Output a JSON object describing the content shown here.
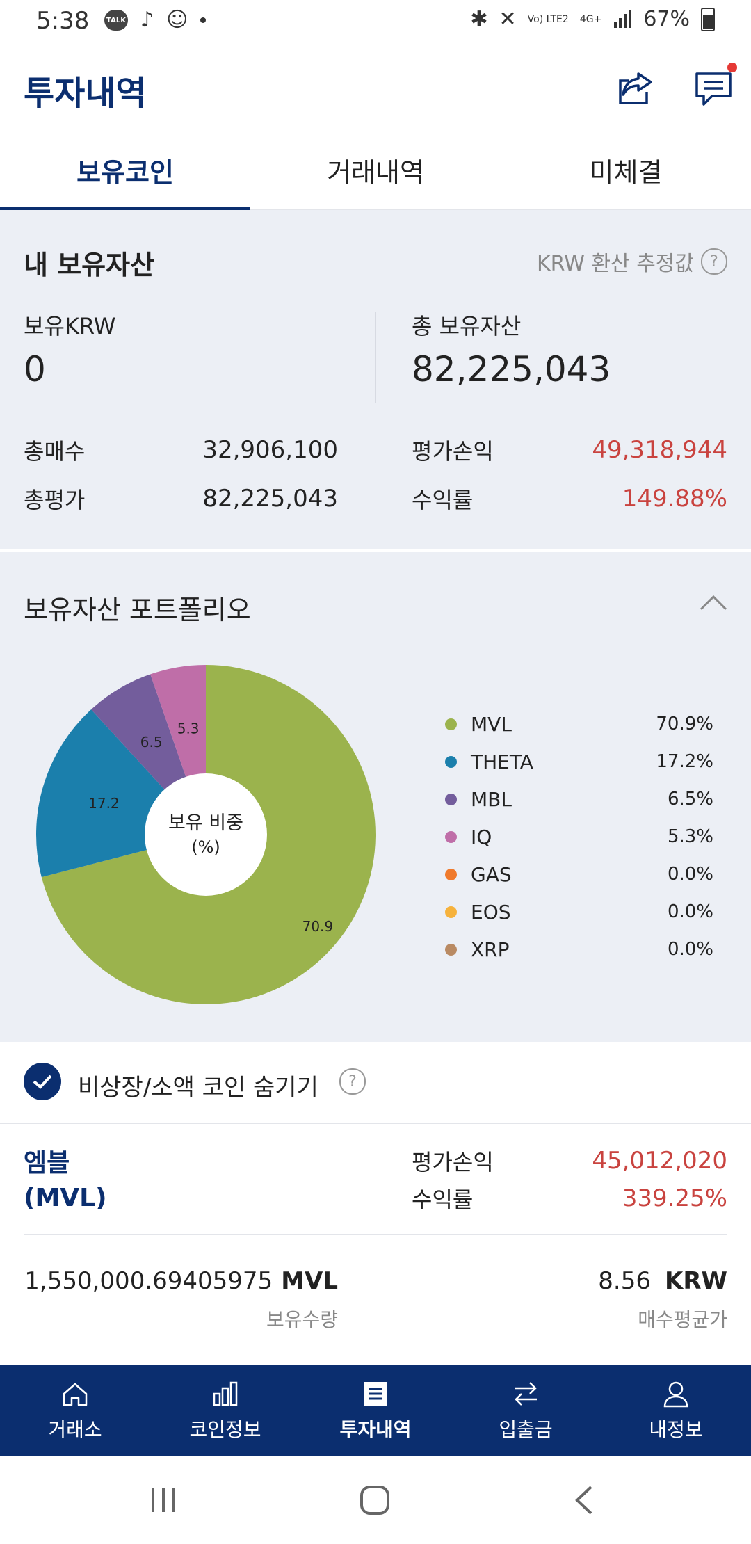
{
  "status_bar": {
    "time": "5:38",
    "talk_label": "TALK",
    "network": "Vo) LTE2",
    "net_type": "4G+",
    "battery": "67%"
  },
  "header": {
    "title": "투자내역"
  },
  "tabs": [
    {
      "label": "보유코인",
      "active": true
    },
    {
      "label": "거래내역",
      "active": false
    },
    {
      "label": "미체결",
      "active": false
    }
  ],
  "assets": {
    "title": "내 보유자산",
    "krw_note": "KRW 환산 추정값",
    "help_symbol": "?",
    "krw_label": "보유KRW",
    "krw_value": "0",
    "total_label": "총 보유자산",
    "total_value": "82,225,043",
    "total_buy_label": "총매수",
    "total_buy_value": "32,906,100",
    "total_eval_label": "총평가",
    "total_eval_value": "82,225,043",
    "pnl_label": "평가손익",
    "pnl_value": "49,318,944",
    "return_label": "수익률",
    "return_value": "149.88%"
  },
  "portfolio": {
    "title": "보유자산 포트폴리오",
    "center_label_1": "보유 비중",
    "center_label_2": "(%)",
    "colors": {
      "MVL": "#9bb34d",
      "THETA": "#1b7fac",
      "MBL": "#735d9c",
      "IQ": "#bf6ea8",
      "GAS": "#f07a2c",
      "EOS": "#f6b23c",
      "XRP": "#b98a63"
    },
    "legend": [
      {
        "name": "MVL",
        "pct": "70.9%"
      },
      {
        "name": "THETA",
        "pct": "17.2%"
      },
      {
        "name": "MBL",
        "pct": "6.5%"
      },
      {
        "name": "IQ",
        "pct": "5.3%"
      },
      {
        "name": "GAS",
        "pct": "0.0%"
      },
      {
        "name": "EOS",
        "pct": "0.0%"
      },
      {
        "name": "XRP",
        "pct": "0.0%"
      }
    ]
  },
  "chart_data": {
    "type": "pie",
    "title": "보유 비중 (%)",
    "categories": [
      "MVL",
      "THETA",
      "MBL",
      "IQ",
      "GAS",
      "EOS",
      "XRP"
    ],
    "values": [
      70.9,
      17.2,
      6.5,
      5.3,
      0.0,
      0.0,
      0.0
    ],
    "data_labels": [
      "70.9",
      "17.2",
      "6.5",
      "5.3"
    ],
    "legend_placement": "right"
  },
  "hide_small": {
    "label": "비상장/소액 코인 숨기기",
    "checked": true
  },
  "coin": {
    "name": "엠블",
    "symbol": "(MVL)",
    "pnl_label": "평가손익",
    "pnl_value": "45,012,020",
    "return_label": "수익률",
    "return_value": "339.25%",
    "quantity": "1,550,000.69405975",
    "quantity_unit": "MVL",
    "quantity_label": "보유수량",
    "avg_price": "8.56",
    "avg_unit": "KRW",
    "avg_label": "매수평균가"
  },
  "bottom_nav": [
    {
      "label": "거래소",
      "icon": "home-icon"
    },
    {
      "label": "코인정보",
      "icon": "bar-chart-icon"
    },
    {
      "label": "투자내역",
      "icon": "document-icon",
      "active": true
    },
    {
      "label": "입출금",
      "icon": "transfer-icon"
    },
    {
      "label": "내정보",
      "icon": "person-icon"
    }
  ]
}
